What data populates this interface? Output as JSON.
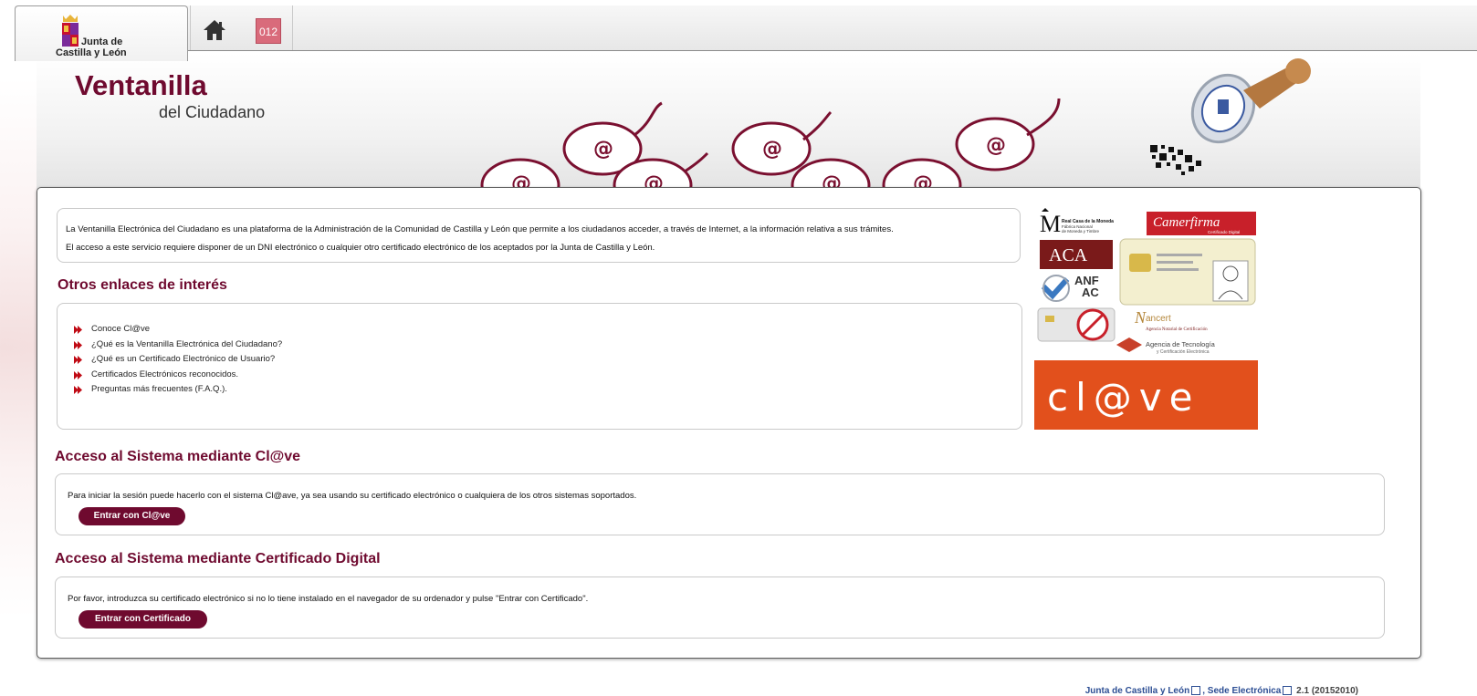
{
  "header": {
    "logo_line1": "Junta de",
    "logo_line2": "Castilla y León",
    "home_icon": "home-icon",
    "btn_012_label": "012"
  },
  "banner": {
    "title": "Ventanilla",
    "subtitle": "del Ciudadano"
  },
  "intro": {
    "line1": "La Ventanilla Electrónica del Ciudadano es una plataforma de la Administración de la Comunidad de Castilla y León que permite a los ciudadanos acceder, a través de Internet, a la información relativa a sus trámites.",
    "line2": "El acceso a este servicio requiere disponer de un DNI electrónico o cualquier otro certificado electrónico de los aceptados por la Junta de Castilla y León."
  },
  "links_section": {
    "heading": "Otros enlaces de interés",
    "items": [
      "Conoce Cl@ve",
      "¿Qué es la Ventanilla Electrónica del Ciudadano?",
      "¿Qué es un Certificado Electrónico de Usuario?",
      "Certificados Electrónicos reconocidos.",
      "Preguntas más frecuentes (F.A.Q.)."
    ]
  },
  "clave_section": {
    "heading": "Acceso al Sistema mediante Cl@ve",
    "text": "Para iniciar la sesión puede hacerlo con el sistema Cl@ave, ya sea usando su certificado electrónico o cualquiera de los otros sistemas soportados.",
    "button": "Entrar con Cl@ve"
  },
  "cert_section": {
    "heading": "Acceso al Sistema mediante Certificado Digital",
    "text": "Por favor, introduzca su certificado electrónico si no lo tiene instalado en el navegador de su ordenador y pulse \"Entrar con Certificado\".",
    "button": "Entrar con Certificado"
  },
  "logos": {
    "fnmt_line1": "Real Casa de la Moneda",
    "fnmt_line2": "Fábrica Nacional",
    "fnmt_line3": "de Moneda y Timbre",
    "camerfirma": "Camerfirma",
    "camerfirma_sub": "Certificado Digital",
    "aca": "ACA",
    "anf": "ANF",
    "ac": "AC",
    "ancert": "ancert",
    "ancert_sub": "Agencia Notarial de Certificación",
    "agencia_line1": "Agencia de Tecnología",
    "agencia_line2": "y Certificación Electrónica",
    "clave": "cl@ve"
  },
  "footer": {
    "link1": "Junta de Castilla y León",
    "link2": "Sede Electrónica",
    "version": "2.1 (20152010)"
  },
  "colors": {
    "brand": "#6f0a2f",
    "link": "#2c4e94",
    "clave_bg": "#e2501c"
  }
}
